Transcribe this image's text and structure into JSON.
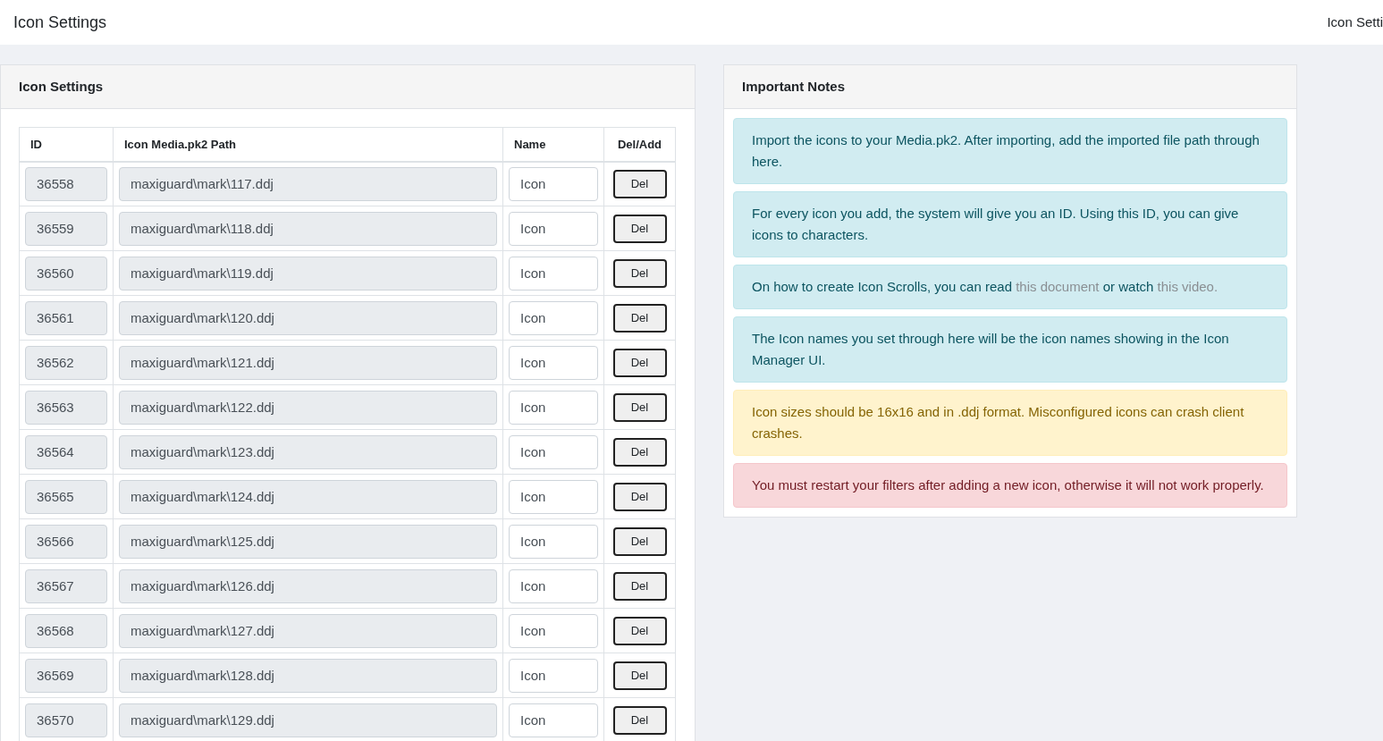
{
  "header": {
    "title": "Icon Settings",
    "breadcrumb": "Icon Setti"
  },
  "icon_settings": {
    "title": "Icon Settings",
    "columns": [
      "ID",
      "Icon Media.pk2 Path",
      "Name",
      "Del/Add"
    ],
    "rows": [
      {
        "id": "36558",
        "path": "maxiguard\\mark\\117.ddj",
        "name": "Icon",
        "action": "Del"
      },
      {
        "id": "36559",
        "path": "maxiguard\\mark\\118.ddj",
        "name": "Icon",
        "action": "Del"
      },
      {
        "id": "36560",
        "path": "maxiguard\\mark\\119.ddj",
        "name": "Icon",
        "action": "Del"
      },
      {
        "id": "36561",
        "path": "maxiguard\\mark\\120.ddj",
        "name": "Icon",
        "action": "Del"
      },
      {
        "id": "36562",
        "path": "maxiguard\\mark\\121.ddj",
        "name": "Icon",
        "action": "Del"
      },
      {
        "id": "36563",
        "path": "maxiguard\\mark\\122.ddj",
        "name": "Icon",
        "action": "Del"
      },
      {
        "id": "36564",
        "path": "maxiguard\\mark\\123.ddj",
        "name": "Icon",
        "action": "Del"
      },
      {
        "id": "36565",
        "path": "maxiguard\\mark\\124.ddj",
        "name": "Icon",
        "action": "Del"
      },
      {
        "id": "36566",
        "path": "maxiguard\\mark\\125.ddj",
        "name": "Icon",
        "action": "Del"
      },
      {
        "id": "36567",
        "path": "maxiguard\\mark\\126.ddj",
        "name": "Icon",
        "action": "Del"
      },
      {
        "id": "36568",
        "path": "maxiguard\\mark\\127.ddj",
        "name": "Icon",
        "action": "Del"
      },
      {
        "id": "36569",
        "path": "maxiguard\\mark\\128.ddj",
        "name": "Icon",
        "action": "Del"
      },
      {
        "id": "36570",
        "path": "maxiguard\\mark\\129.ddj",
        "name": "Icon",
        "action": "Del"
      }
    ]
  },
  "important_notes": {
    "title": "Important Notes",
    "notes": [
      {
        "kind": "info",
        "parts": [
          {
            "kind": "text",
            "text": "Import the icons to your Media.pk2. After importing, add the imported file path through here."
          }
        ]
      },
      {
        "kind": "info",
        "parts": [
          {
            "kind": "text",
            "text": "For every icon you add, the system will give you an ID. Using this ID, you can give icons to characters."
          }
        ]
      },
      {
        "kind": "info",
        "parts": [
          {
            "kind": "text",
            "text": "On how to create Icon Scrolls, you can read "
          },
          {
            "kind": "link",
            "text": "this document"
          },
          {
            "kind": "text",
            "text": " or watch "
          },
          {
            "kind": "link",
            "text": "this video."
          }
        ]
      },
      {
        "kind": "info",
        "parts": [
          {
            "kind": "text",
            "text": "The Icon names you set through here will be the icon names showing in the Icon Manager UI."
          }
        ]
      },
      {
        "kind": "warning",
        "parts": [
          {
            "kind": "text",
            "text": "Icon sizes should be 16x16 and in .ddj format. Misconfigured icons can crash client crashes."
          }
        ]
      },
      {
        "kind": "danger",
        "parts": [
          {
            "kind": "text",
            "text": "You must restart your filters after adding a new icon, otherwise it will not work properly."
          }
        ]
      }
    ]
  }
}
